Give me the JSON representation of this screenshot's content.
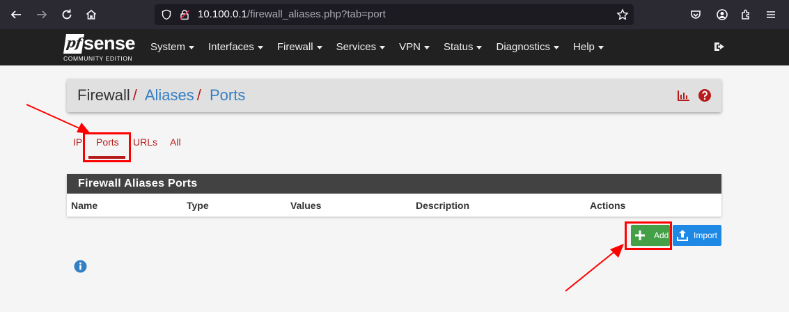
{
  "browser": {
    "url_host": "10.100.0.1",
    "url_path": "/firewall_aliases.php?tab=port"
  },
  "navbar": {
    "logo_mark": "pf",
    "logo_word": "sense",
    "logo_edition": "COMMUNITY EDITION",
    "menu": [
      "System",
      "Interfaces",
      "Firewall",
      "Services",
      "VPN",
      "Status",
      "Diagnostics",
      "Help"
    ]
  },
  "breadcrumb": {
    "first": "Firewall",
    "second": "Aliases",
    "third": "Ports",
    "separator": "/"
  },
  "tabs": {
    "ip": "IP",
    "ports": "Ports",
    "urls": "URLs",
    "all": "All"
  },
  "panel": {
    "title": "Firewall Aliases Ports",
    "columns": [
      "Name",
      "Type",
      "Values",
      "Description",
      "Actions"
    ]
  },
  "actions": {
    "add_label": "Add",
    "import_label": "Import"
  },
  "colors": {
    "accent_red": "#b71c1c",
    "link_blue": "#3480c4",
    "add_green": "#43a047",
    "import_blue": "#1e88e5",
    "annotation_red": "#ff0000"
  }
}
